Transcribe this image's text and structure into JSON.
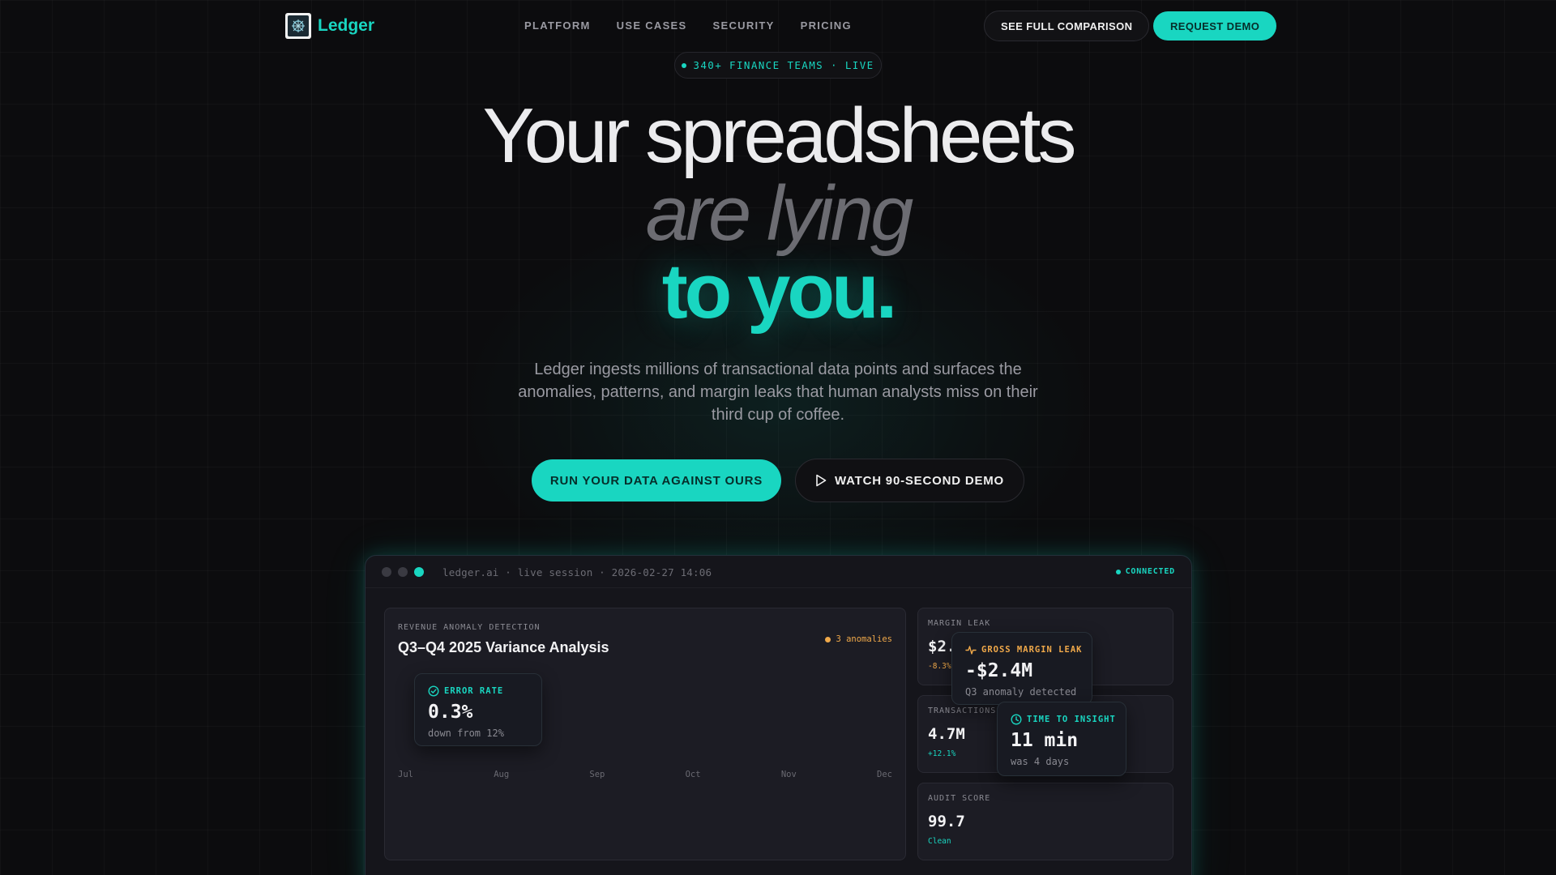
{
  "brand": {
    "name": "Ledger"
  },
  "nav": {
    "links": [
      "PLATFORM",
      "USE CASES",
      "SECURITY",
      "PRICING"
    ],
    "compare_label": "SEE FULL COMPARISON",
    "demo_label": "REQUEST DEMO"
  },
  "badge": {
    "text": "340+ FINANCE TEAMS · LIVE"
  },
  "hero": {
    "line1": "Your spreadsheets",
    "line2": "are lying",
    "line3": "to you.",
    "subtitle": "Ledger ingests millions of transactional data points and surfaces the anomalies, patterns, and margin leaks that human analysts miss on their third cup of coffee.",
    "cta_primary": "RUN YOUR DATA AGAINST OURS",
    "cta_secondary": "WATCH 90-SECOND DEMO"
  },
  "dashboard": {
    "url": "ledger.ai · live session · 2026-02-27 14:06",
    "status": "CONNECTED",
    "main": {
      "label": "REVENUE ANOMALY DETECTION",
      "title": "Q3–Q4 2025 Variance Analysis",
      "anomalies": "3 anomalies",
      "months": [
        "Jul",
        "Aug",
        "Sep",
        "Oct",
        "Nov",
        "Dec"
      ]
    },
    "error_rate": {
      "label": "ERROR RATE",
      "value": "0.3%",
      "note": "down from 12%"
    },
    "margin_leak": {
      "label": "MARGIN LEAK",
      "value": "$2.",
      "delta": "-8.3%"
    },
    "gross_margin": {
      "label": "GROSS MARGIN LEAK",
      "value": "-$2.4M",
      "note": "Q3 anomaly detected"
    },
    "transactions": {
      "label": "TRANSACTIONS",
      "value": "4.7M",
      "delta": "+12.1%"
    },
    "time_to_insight": {
      "label": "TIME TO INSIGHT",
      "value": "11 min",
      "note": "was 4 days"
    },
    "audit": {
      "label": "AUDIT SCORE",
      "value": "99.7",
      "status": "Clean"
    }
  },
  "colors": {
    "accent": "#19d6c1",
    "warning": "#f0a94a",
    "background": "#0c0c0e"
  }
}
